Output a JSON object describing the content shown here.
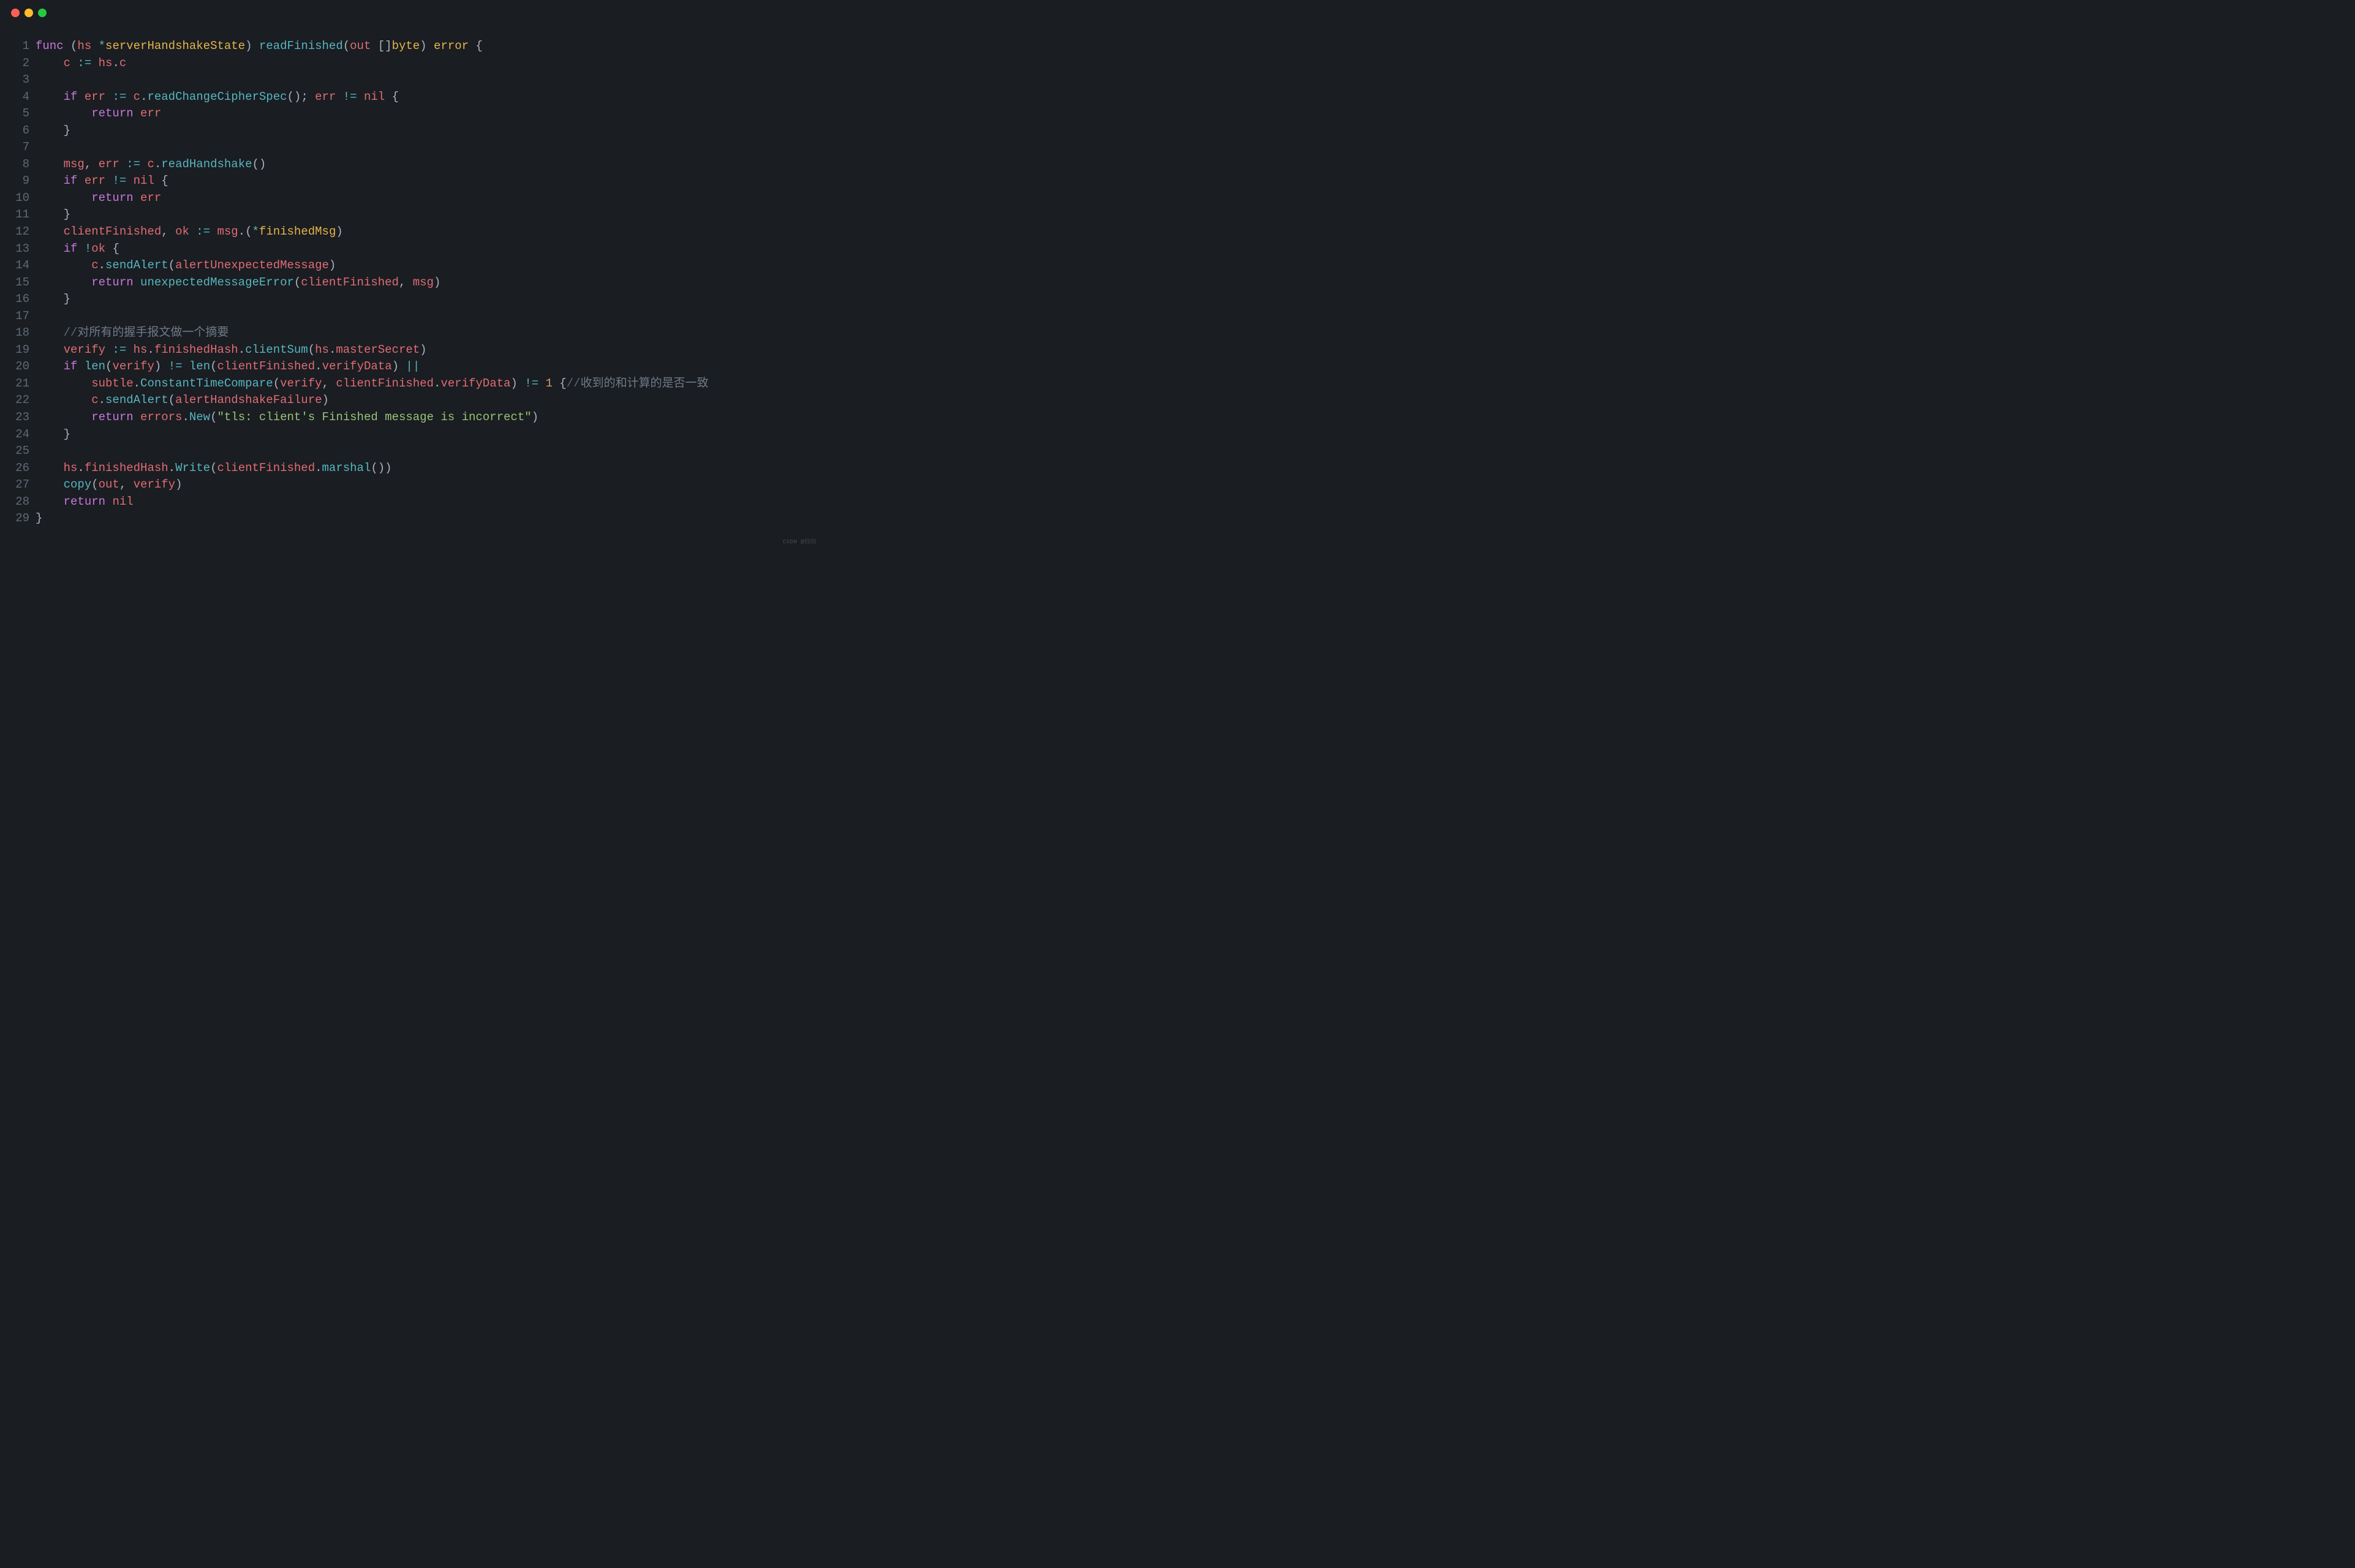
{
  "window": {
    "controls": [
      "close",
      "minimize",
      "maximize"
    ]
  },
  "code": {
    "lines": [
      {
        "n": 1,
        "tokens": [
          {
            "t": "func ",
            "c": "kw"
          },
          {
            "t": "(",
            "c": "pu"
          },
          {
            "t": "hs ",
            "c": "id"
          },
          {
            "t": "*",
            "c": "op"
          },
          {
            "t": "serverHandshakeState",
            "c": "tp"
          },
          {
            "t": ") ",
            "c": "pu"
          },
          {
            "t": "readFinished",
            "c": "fn"
          },
          {
            "t": "(",
            "c": "pu"
          },
          {
            "t": "out ",
            "c": "id"
          },
          {
            "t": "[]",
            "c": "pu"
          },
          {
            "t": "byte",
            "c": "tp"
          },
          {
            "t": ") ",
            "c": "pu"
          },
          {
            "t": "error",
            "c": "tp"
          },
          {
            "t": " {",
            "c": "pu"
          }
        ]
      },
      {
        "n": 2,
        "tokens": [
          {
            "t": "    ",
            "c": "pu"
          },
          {
            "t": "c",
            "c": "id"
          },
          {
            "t": " := ",
            "c": "op"
          },
          {
            "t": "hs",
            "c": "id"
          },
          {
            "t": ".",
            "c": "pu"
          },
          {
            "t": "c",
            "c": "id"
          }
        ]
      },
      {
        "n": 3,
        "tokens": []
      },
      {
        "n": 4,
        "tokens": [
          {
            "t": "    ",
            "c": "pu"
          },
          {
            "t": "if ",
            "c": "kw"
          },
          {
            "t": "err",
            "c": "id"
          },
          {
            "t": " := ",
            "c": "op"
          },
          {
            "t": "c",
            "c": "id"
          },
          {
            "t": ".",
            "c": "pu"
          },
          {
            "t": "readChangeCipherSpec",
            "c": "fn"
          },
          {
            "t": "(); ",
            "c": "pu"
          },
          {
            "t": "err",
            "c": "id"
          },
          {
            "t": " != ",
            "c": "op"
          },
          {
            "t": "nil",
            "c": "id"
          },
          {
            "t": " {",
            "c": "pu"
          }
        ]
      },
      {
        "n": 5,
        "tokens": [
          {
            "t": "        ",
            "c": "pu"
          },
          {
            "t": "return ",
            "c": "kw"
          },
          {
            "t": "err",
            "c": "id"
          }
        ]
      },
      {
        "n": 6,
        "tokens": [
          {
            "t": "    }",
            "c": "pu"
          }
        ]
      },
      {
        "n": 7,
        "tokens": []
      },
      {
        "n": 8,
        "tokens": [
          {
            "t": "    ",
            "c": "pu"
          },
          {
            "t": "msg",
            "c": "id"
          },
          {
            "t": ", ",
            "c": "pu"
          },
          {
            "t": "err",
            "c": "id"
          },
          {
            "t": " := ",
            "c": "op"
          },
          {
            "t": "c",
            "c": "id"
          },
          {
            "t": ".",
            "c": "pu"
          },
          {
            "t": "readHandshake",
            "c": "fn"
          },
          {
            "t": "()",
            "c": "pu"
          }
        ]
      },
      {
        "n": 9,
        "tokens": [
          {
            "t": "    ",
            "c": "pu"
          },
          {
            "t": "if ",
            "c": "kw"
          },
          {
            "t": "err",
            "c": "id"
          },
          {
            "t": " != ",
            "c": "op"
          },
          {
            "t": "nil",
            "c": "id"
          },
          {
            "t": " {",
            "c": "pu"
          }
        ]
      },
      {
        "n": 10,
        "tokens": [
          {
            "t": "        ",
            "c": "pu"
          },
          {
            "t": "return ",
            "c": "kw"
          },
          {
            "t": "err",
            "c": "id"
          }
        ]
      },
      {
        "n": 11,
        "tokens": [
          {
            "t": "    }",
            "c": "pu"
          }
        ]
      },
      {
        "n": 12,
        "tokens": [
          {
            "t": "    ",
            "c": "pu"
          },
          {
            "t": "clientFinished",
            "c": "id"
          },
          {
            "t": ", ",
            "c": "pu"
          },
          {
            "t": "ok",
            "c": "id"
          },
          {
            "t": " := ",
            "c": "op"
          },
          {
            "t": "msg",
            "c": "id"
          },
          {
            "t": ".(",
            "c": "pu"
          },
          {
            "t": "*",
            "c": "op"
          },
          {
            "t": "finishedMsg",
            "c": "tp"
          },
          {
            "t": ")",
            "c": "pu"
          }
        ]
      },
      {
        "n": 13,
        "tokens": [
          {
            "t": "    ",
            "c": "pu"
          },
          {
            "t": "if ",
            "c": "kw"
          },
          {
            "t": "!",
            "c": "op"
          },
          {
            "t": "ok",
            "c": "id"
          },
          {
            "t": " {",
            "c": "pu"
          }
        ]
      },
      {
        "n": 14,
        "tokens": [
          {
            "t": "        ",
            "c": "pu"
          },
          {
            "t": "c",
            "c": "id"
          },
          {
            "t": ".",
            "c": "pu"
          },
          {
            "t": "sendAlert",
            "c": "fn"
          },
          {
            "t": "(",
            "c": "pu"
          },
          {
            "t": "alertUnexpectedMessage",
            "c": "id"
          },
          {
            "t": ")",
            "c": "pu"
          }
        ]
      },
      {
        "n": 15,
        "tokens": [
          {
            "t": "        ",
            "c": "pu"
          },
          {
            "t": "return ",
            "c": "kw"
          },
          {
            "t": "unexpectedMessageError",
            "c": "fn"
          },
          {
            "t": "(",
            "c": "pu"
          },
          {
            "t": "clientFinished",
            "c": "id"
          },
          {
            "t": ", ",
            "c": "pu"
          },
          {
            "t": "msg",
            "c": "id"
          },
          {
            "t": ")",
            "c": "pu"
          }
        ]
      },
      {
        "n": 16,
        "tokens": [
          {
            "t": "    }",
            "c": "pu"
          }
        ]
      },
      {
        "n": 17,
        "tokens": []
      },
      {
        "n": 18,
        "tokens": [
          {
            "t": "    ",
            "c": "pu"
          },
          {
            "t": "//",
            "c": "cm"
          },
          {
            "t": "对所有的握手报文做一个摘要",
            "c": "cm-zh"
          }
        ]
      },
      {
        "n": 19,
        "tokens": [
          {
            "t": "    ",
            "c": "pu"
          },
          {
            "t": "verify",
            "c": "id"
          },
          {
            "t": " := ",
            "c": "op"
          },
          {
            "t": "hs",
            "c": "id"
          },
          {
            "t": ".",
            "c": "pu"
          },
          {
            "t": "finishedHash",
            "c": "id"
          },
          {
            "t": ".",
            "c": "pu"
          },
          {
            "t": "clientSum",
            "c": "fn"
          },
          {
            "t": "(",
            "c": "pu"
          },
          {
            "t": "hs",
            "c": "id"
          },
          {
            "t": ".",
            "c": "pu"
          },
          {
            "t": "masterSecret",
            "c": "id"
          },
          {
            "t": ")",
            "c": "pu"
          }
        ]
      },
      {
        "n": 20,
        "tokens": [
          {
            "t": "    ",
            "c": "pu"
          },
          {
            "t": "if ",
            "c": "kw"
          },
          {
            "t": "len",
            "c": "fn"
          },
          {
            "t": "(",
            "c": "pu"
          },
          {
            "t": "verify",
            "c": "id"
          },
          {
            "t": ") ",
            "c": "pu"
          },
          {
            "t": "!= ",
            "c": "op"
          },
          {
            "t": "len",
            "c": "fn"
          },
          {
            "t": "(",
            "c": "pu"
          },
          {
            "t": "clientFinished",
            "c": "id"
          },
          {
            "t": ".",
            "c": "pu"
          },
          {
            "t": "verifyData",
            "c": "id"
          },
          {
            "t": ") ",
            "c": "pu"
          },
          {
            "t": "||",
            "c": "op"
          }
        ]
      },
      {
        "n": 21,
        "tokens": [
          {
            "t": "        ",
            "c": "pu"
          },
          {
            "t": "subtle",
            "c": "id"
          },
          {
            "t": ".",
            "c": "pu"
          },
          {
            "t": "ConstantTimeCompare",
            "c": "fn"
          },
          {
            "t": "(",
            "c": "pu"
          },
          {
            "t": "verify",
            "c": "id"
          },
          {
            "t": ", ",
            "c": "pu"
          },
          {
            "t": "clientFinished",
            "c": "id"
          },
          {
            "t": ".",
            "c": "pu"
          },
          {
            "t": "verifyData",
            "c": "id"
          },
          {
            "t": ") ",
            "c": "pu"
          },
          {
            "t": "!= ",
            "c": "op"
          },
          {
            "t": "1",
            "c": "num"
          },
          {
            "t": " {",
            "c": "pu"
          },
          {
            "t": "//",
            "c": "cm"
          },
          {
            "t": "收到的和计算的是否一致",
            "c": "cm-zh"
          }
        ]
      },
      {
        "n": 22,
        "tokens": [
          {
            "t": "        ",
            "c": "pu"
          },
          {
            "t": "c",
            "c": "id"
          },
          {
            "t": ".",
            "c": "pu"
          },
          {
            "t": "sendAlert",
            "c": "fn"
          },
          {
            "t": "(",
            "c": "pu"
          },
          {
            "t": "alertHandshakeFailure",
            "c": "id"
          },
          {
            "t": ")",
            "c": "pu"
          }
        ]
      },
      {
        "n": 23,
        "tokens": [
          {
            "t": "        ",
            "c": "pu"
          },
          {
            "t": "return ",
            "c": "kw"
          },
          {
            "t": "errors",
            "c": "id"
          },
          {
            "t": ".",
            "c": "pu"
          },
          {
            "t": "New",
            "c": "fn"
          },
          {
            "t": "(",
            "c": "pu"
          },
          {
            "t": "\"tls: client's Finished message is incorrect\"",
            "c": "str"
          },
          {
            "t": ")",
            "c": "pu"
          }
        ]
      },
      {
        "n": 24,
        "tokens": [
          {
            "t": "    }",
            "c": "pu"
          }
        ]
      },
      {
        "n": 25,
        "tokens": []
      },
      {
        "n": 26,
        "tokens": [
          {
            "t": "    ",
            "c": "pu"
          },
          {
            "t": "hs",
            "c": "id"
          },
          {
            "t": ".",
            "c": "pu"
          },
          {
            "t": "finishedHash",
            "c": "id"
          },
          {
            "t": ".",
            "c": "pu"
          },
          {
            "t": "Write",
            "c": "fn"
          },
          {
            "t": "(",
            "c": "pu"
          },
          {
            "t": "clientFinished",
            "c": "id"
          },
          {
            "t": ".",
            "c": "pu"
          },
          {
            "t": "marshal",
            "c": "fn"
          },
          {
            "t": "())",
            "c": "pu"
          }
        ]
      },
      {
        "n": 27,
        "tokens": [
          {
            "t": "    ",
            "c": "pu"
          },
          {
            "t": "copy",
            "c": "fn"
          },
          {
            "t": "(",
            "c": "pu"
          },
          {
            "t": "out",
            "c": "id"
          },
          {
            "t": ", ",
            "c": "pu"
          },
          {
            "t": "verify",
            "c": "id"
          },
          {
            "t": ")",
            "c": "pu"
          }
        ]
      },
      {
        "n": 28,
        "tokens": [
          {
            "t": "    ",
            "c": "pu"
          },
          {
            "t": "return ",
            "c": "kw"
          },
          {
            "t": "nil",
            "c": "id"
          }
        ]
      },
      {
        "n": 29,
        "tokens": [
          {
            "t": "}",
            "c": "pu"
          }
        ]
      }
    ]
  },
  "watermark": "CSDN @归归"
}
